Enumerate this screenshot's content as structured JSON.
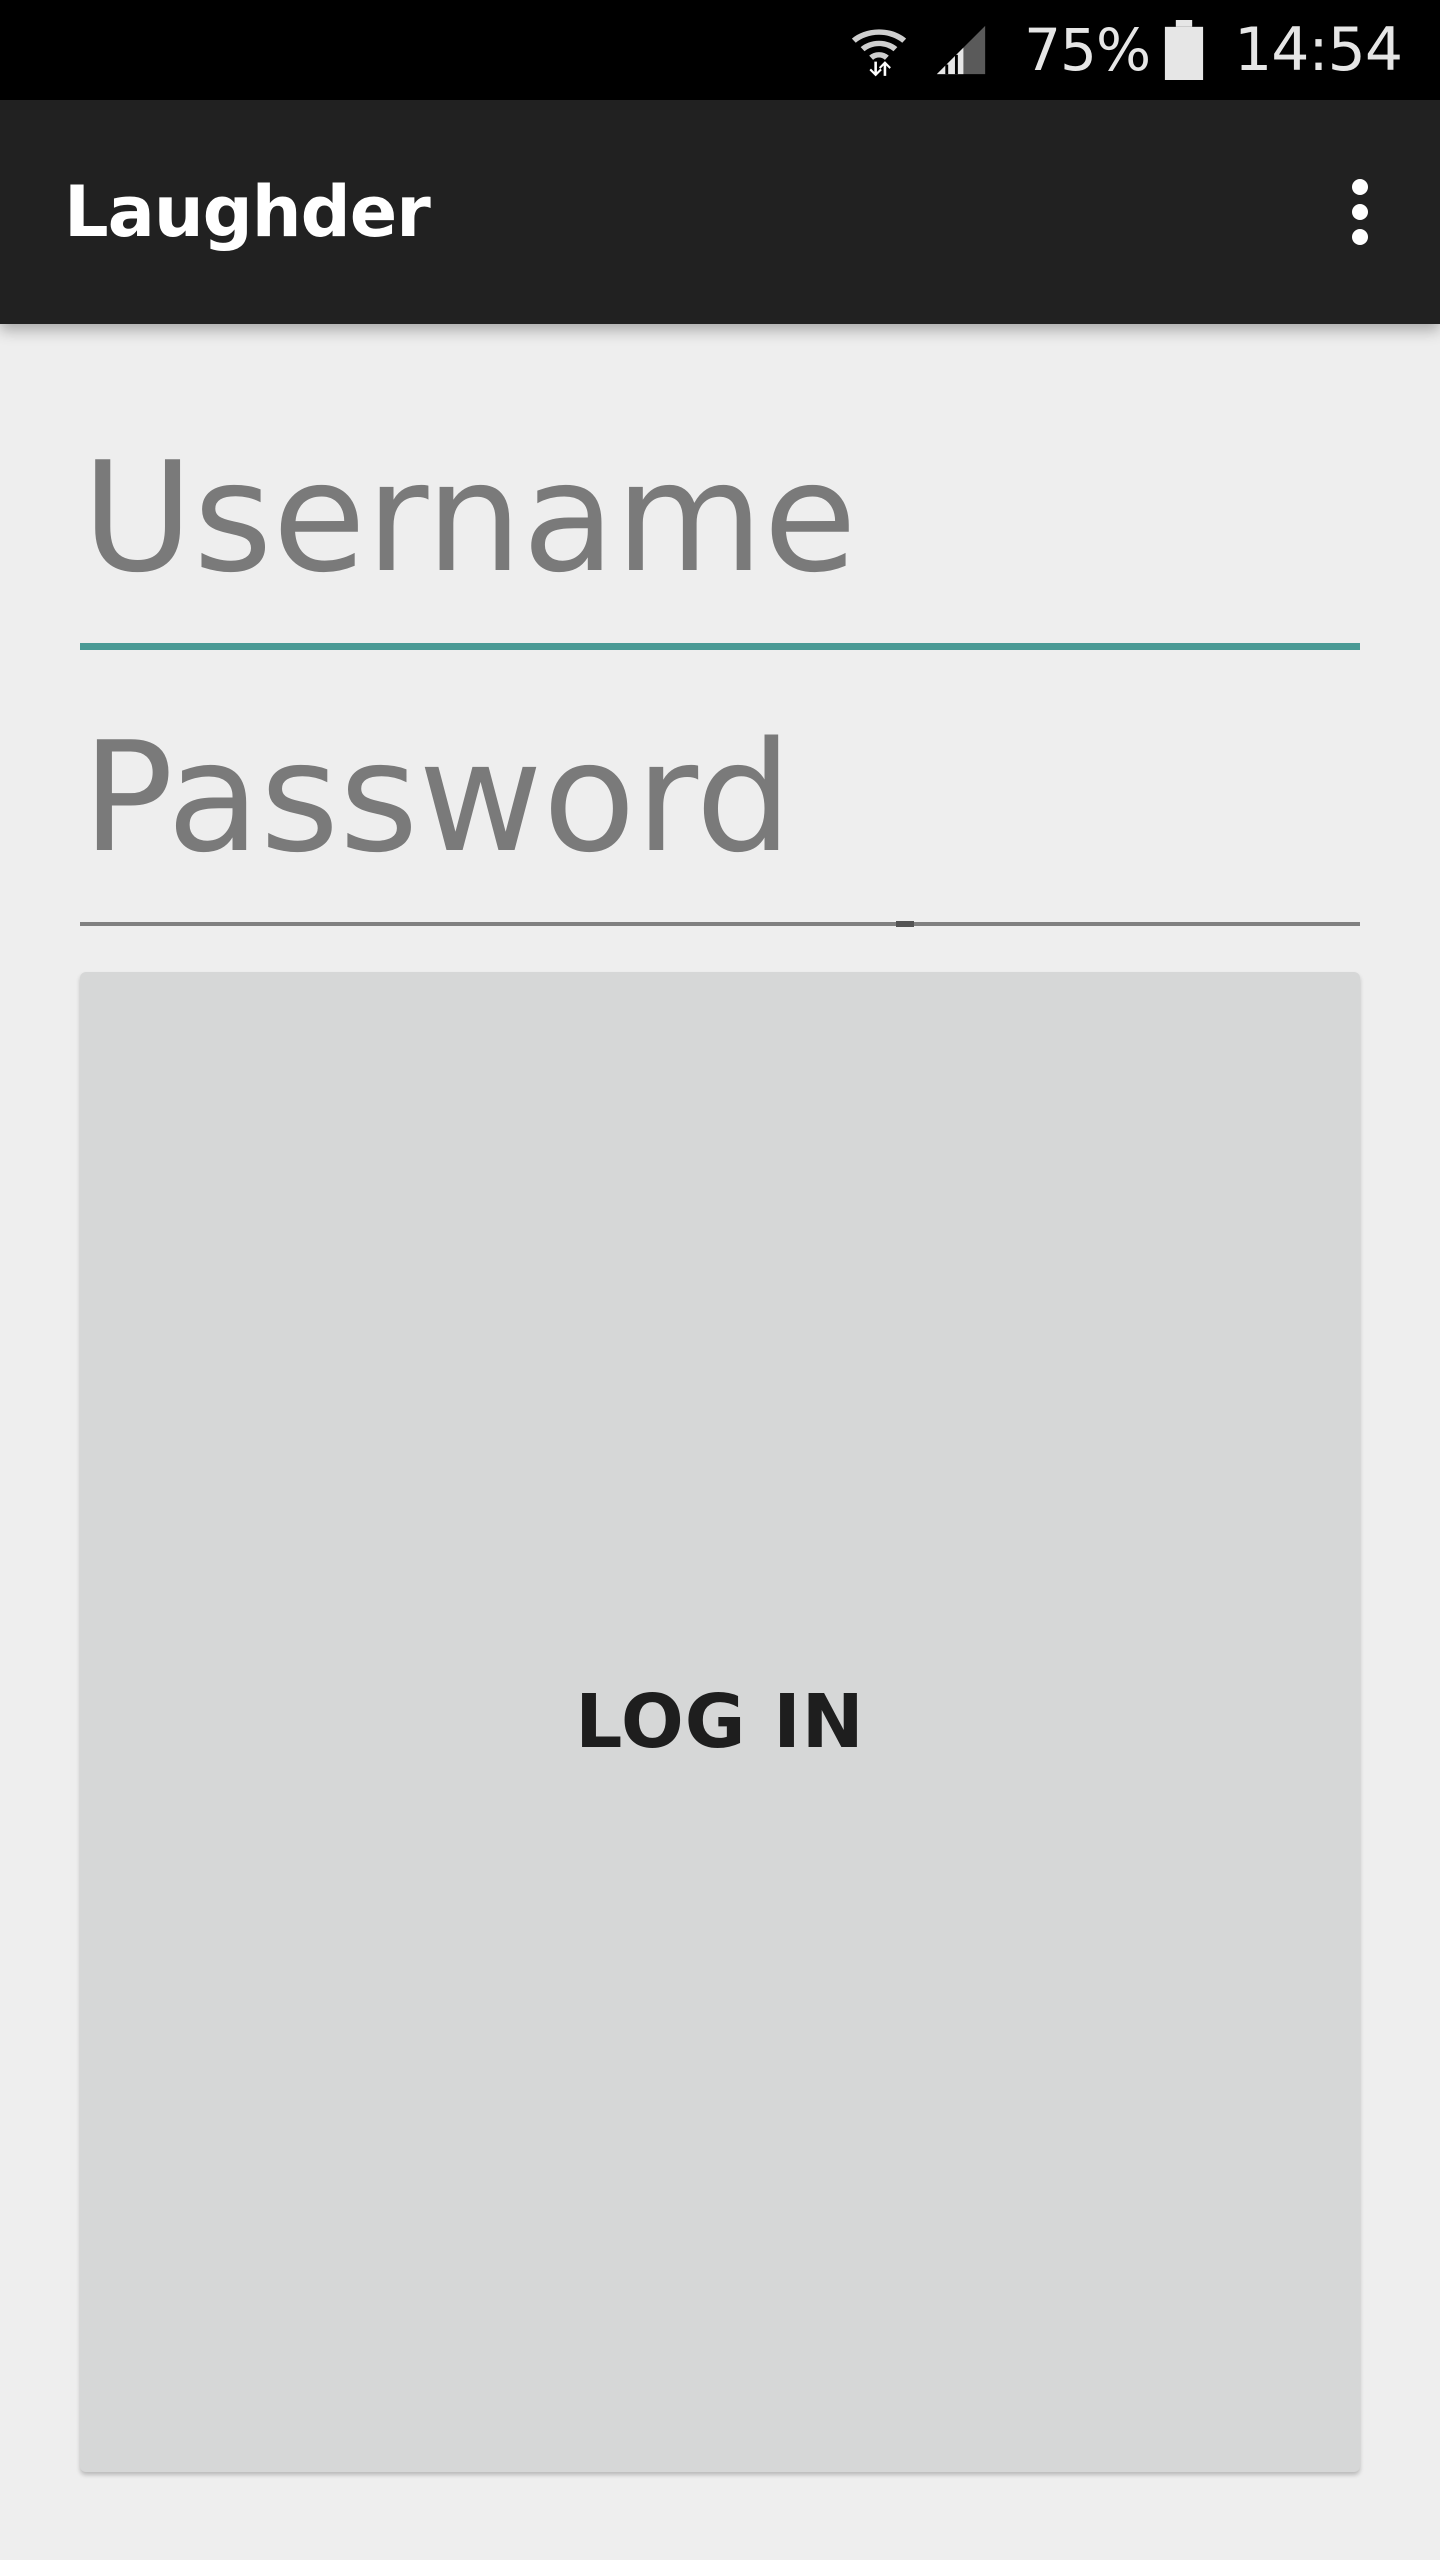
{
  "status_bar": {
    "battery": "75%",
    "time": "14:54",
    "icons": [
      "wifi-icon",
      "signal-icon",
      "battery-icon"
    ]
  },
  "toolbar": {
    "title": "Laughder",
    "overflow_icon": "more-vert-icon"
  },
  "form": {
    "username": {
      "value": "",
      "placeholder": "Username"
    },
    "password": {
      "value": "",
      "placeholder": "Password"
    },
    "login_label": "LOG IN"
  },
  "colors": {
    "toolbar_bg": "#212121",
    "background": "#eeeeee",
    "accent": "#4a9a95",
    "button_bg": "#d6d7d7"
  }
}
